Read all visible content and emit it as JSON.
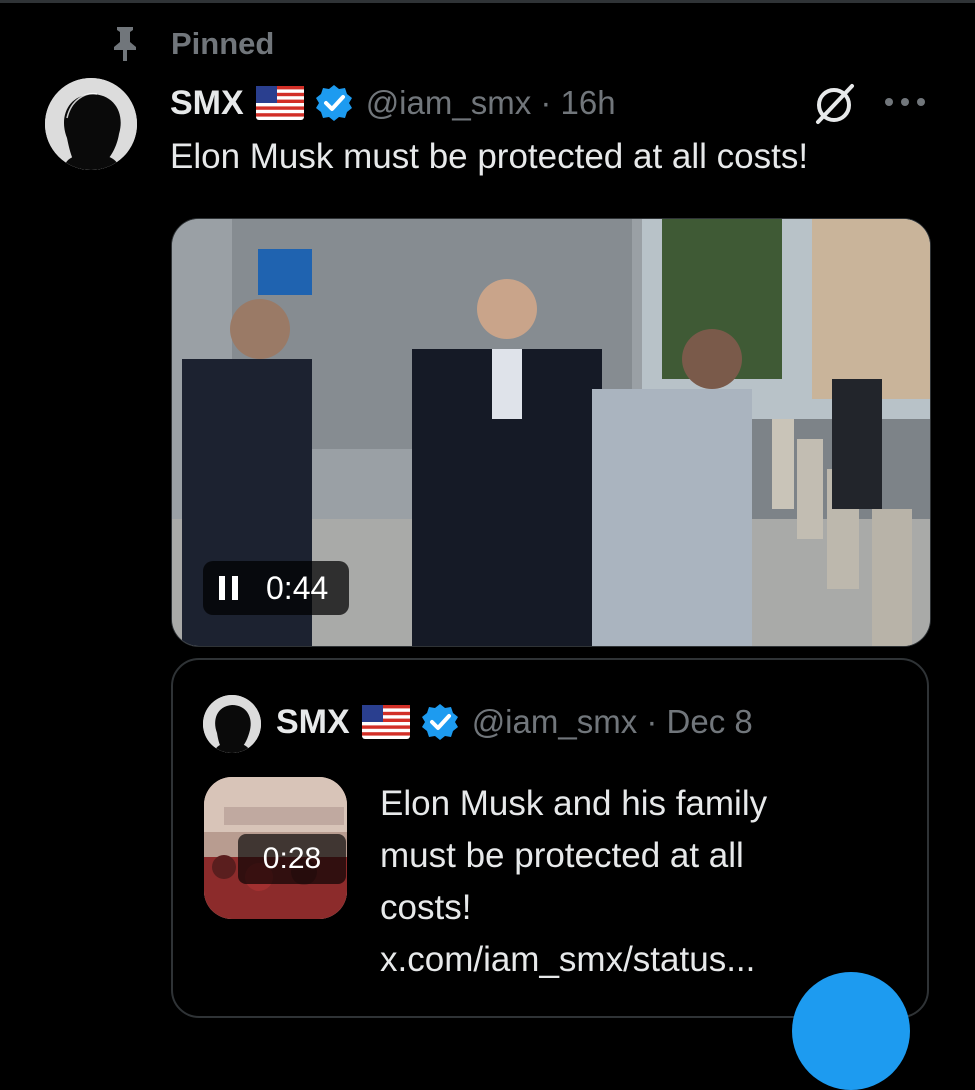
{
  "pinned": {
    "label": "Pinned"
  },
  "tweet": {
    "name": "SMX",
    "handle_time": "@iam_smx · 16h",
    "text": "Elon Musk must be protected at all costs!",
    "video": {
      "duration": "0:44"
    }
  },
  "quote": {
    "name": "SMX",
    "handle_time": "@iam_smx · Dec 8",
    "thumb_duration": "0:28",
    "lines": [
      "Elon Musk and his family",
      "must be protected at all",
      "costs!",
      "x.com/iam_smx/status..."
    ]
  },
  "colors": {
    "accent": "#1d9bf0",
    "muted": "#71767b",
    "text": "#e7e9ea",
    "background": "#000000",
    "border": "#2f3336"
  },
  "icons": {
    "pin": "pin-icon",
    "flag": "us-flag-icon",
    "verified": "verified-badge-icon",
    "grok": "grok-icon",
    "more": "more-icon",
    "pause": "pause-icon"
  }
}
